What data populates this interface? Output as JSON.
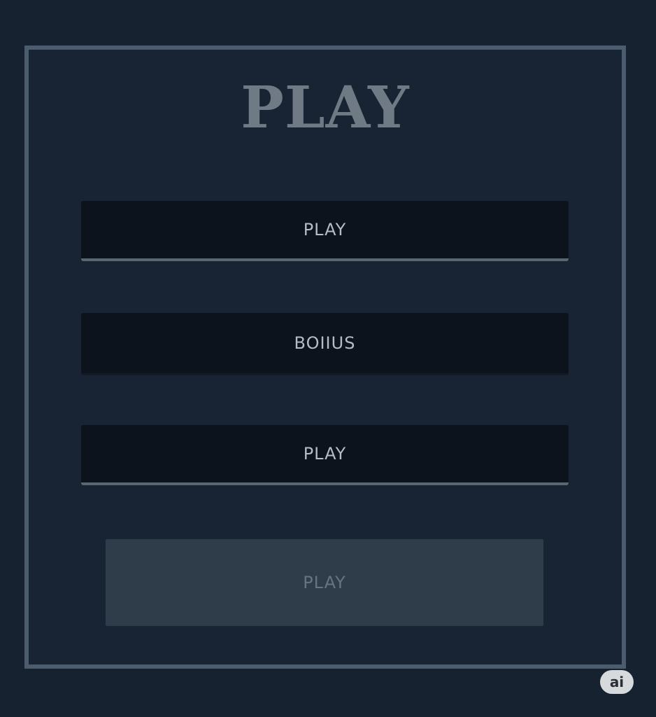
{
  "menu": {
    "title": "PLAY",
    "buttons": [
      {
        "label": "PLAY",
        "state": "normal"
      },
      {
        "label": "BOIIUS",
        "state": "normal"
      },
      {
        "label": "PLAY",
        "state": "normal"
      },
      {
        "label": "PLAY",
        "state": "disabled"
      }
    ]
  },
  "badge": {
    "label": "ai"
  },
  "colors": {
    "background": "#172231",
    "panel_border": "#4a5c6d",
    "button": "#0d131d",
    "button_disabled": "#2f3c4a",
    "title_text": "#6f7a84"
  }
}
